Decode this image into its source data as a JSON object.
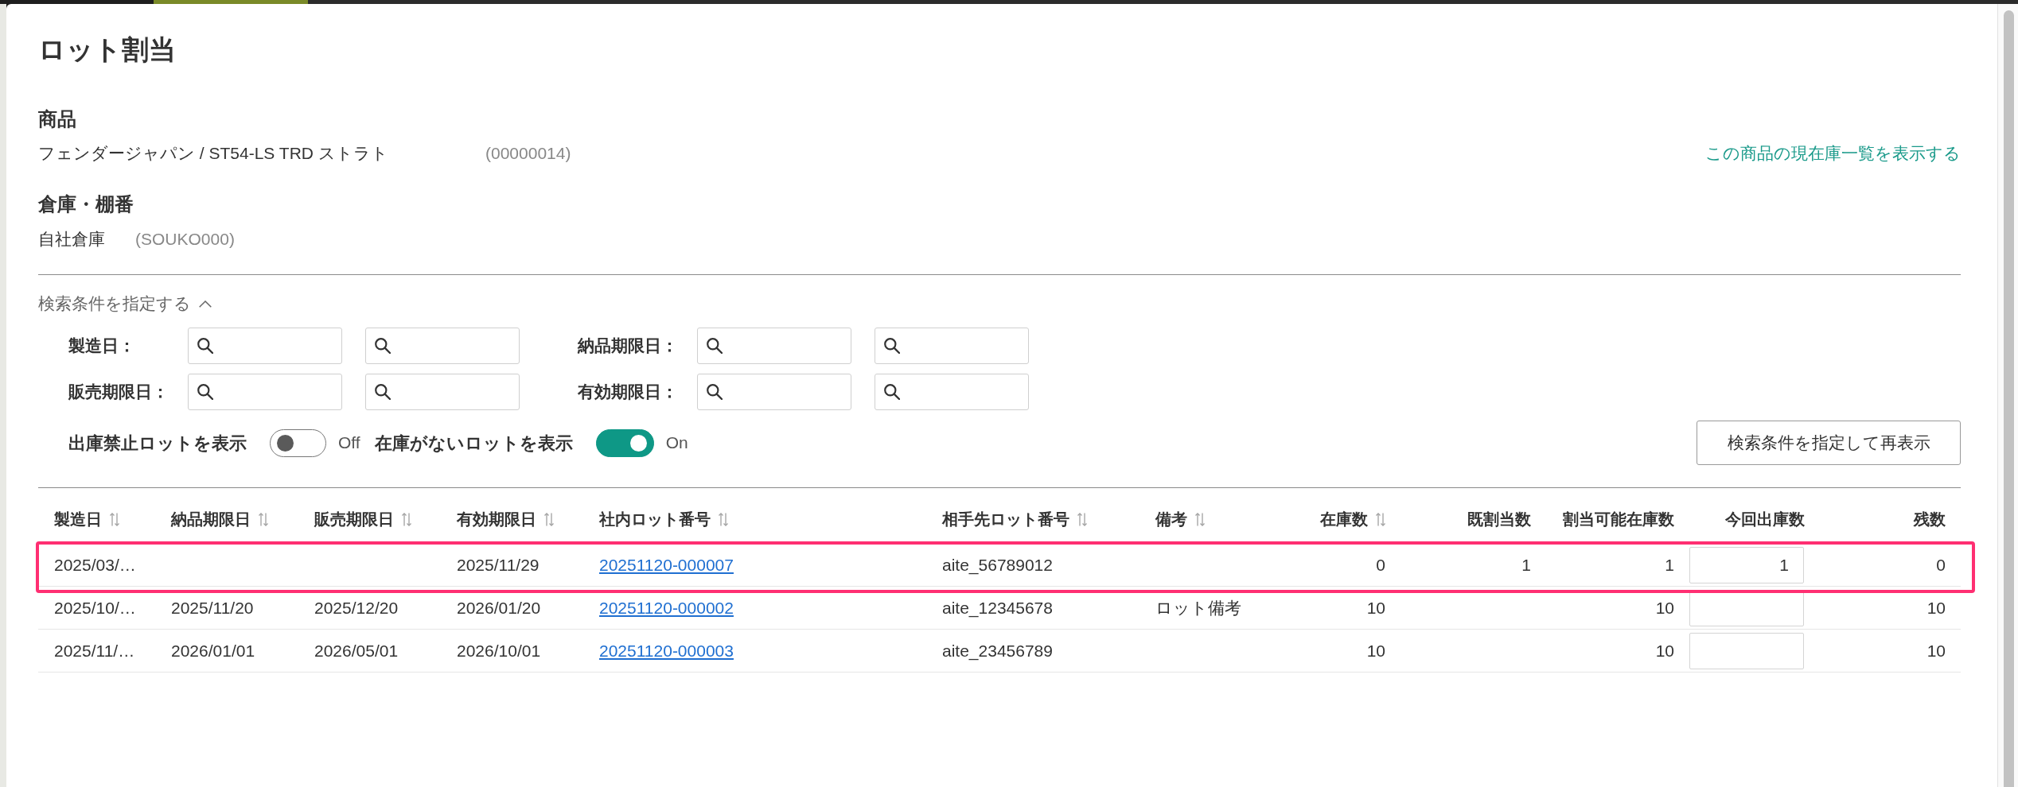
{
  "dialog": {
    "title": "ロット割当"
  },
  "product": {
    "heading": "商品",
    "name": "フェンダージャパン / ST54-LS TRD ストラト",
    "code": "(00000014)",
    "stock_link": "この商品の現在庫一覧を表示する"
  },
  "warehouse": {
    "heading": "倉庫・棚番",
    "name": "自社倉庫",
    "code": "(SOUKO000)"
  },
  "search": {
    "toggle_label": "検索条件を指定する",
    "expanded": true,
    "date_filters": [
      {
        "label": "製造日："
      },
      {
        "label": "納品期限日："
      },
      {
        "label": "販売期限日："
      },
      {
        "label": "有効期限日："
      }
    ],
    "switches": [
      {
        "label": "出庫禁止ロットを表示",
        "on": false,
        "state_text": "Off"
      },
      {
        "label": "在庫がないロットを表示",
        "on": true,
        "state_text": "On"
      }
    ],
    "submit_button": "検索条件を指定して再表示"
  },
  "table": {
    "columns": [
      {
        "label": "製造日",
        "sortable": true,
        "kind": "text"
      },
      {
        "label": "納品期限日",
        "sortable": true,
        "kind": "text"
      },
      {
        "label": "販売期限日",
        "sortable": true,
        "kind": "text"
      },
      {
        "label": "有効期限日",
        "sortable": true,
        "kind": "text"
      },
      {
        "label": "社内ロット番号",
        "sortable": true,
        "kind": "link"
      },
      {
        "label": "相手先ロット番号",
        "sortable": true,
        "kind": "text"
      },
      {
        "label": "備考",
        "sortable": true,
        "kind": "text"
      },
      {
        "label": "在庫数",
        "sortable": true,
        "kind": "number"
      },
      {
        "label": "既割当数",
        "sortable": false,
        "kind": "number"
      },
      {
        "label": "割当可能在庫数",
        "sortable": false,
        "kind": "number"
      },
      {
        "label": "今回出庫数",
        "sortable": false,
        "kind": "input"
      },
      {
        "label": "残数",
        "sortable": false,
        "kind": "number"
      }
    ],
    "rows": [
      {
        "highlighted": true,
        "cells": [
          "2025/03/…",
          null,
          null,
          "2025/11/29",
          "20251120-000007",
          "aite_56789012",
          null,
          "0",
          "1",
          "1",
          "1",
          "0"
        ]
      },
      {
        "highlighted": false,
        "cells": [
          "2025/10/…",
          "2025/11/20",
          "2025/12/20",
          "2026/01/20",
          "20251120-000002",
          "aite_12345678",
          "ロット備考",
          "10",
          null,
          "10",
          null,
          "10"
        ]
      },
      {
        "highlighted": false,
        "cells": [
          "2025/11/…",
          "2026/01/01",
          "2026/05/01",
          "2026/10/01",
          "20251120-000003",
          "aite_23456789",
          null,
          "10",
          null,
          "10",
          null,
          "10"
        ]
      }
    ]
  }
}
